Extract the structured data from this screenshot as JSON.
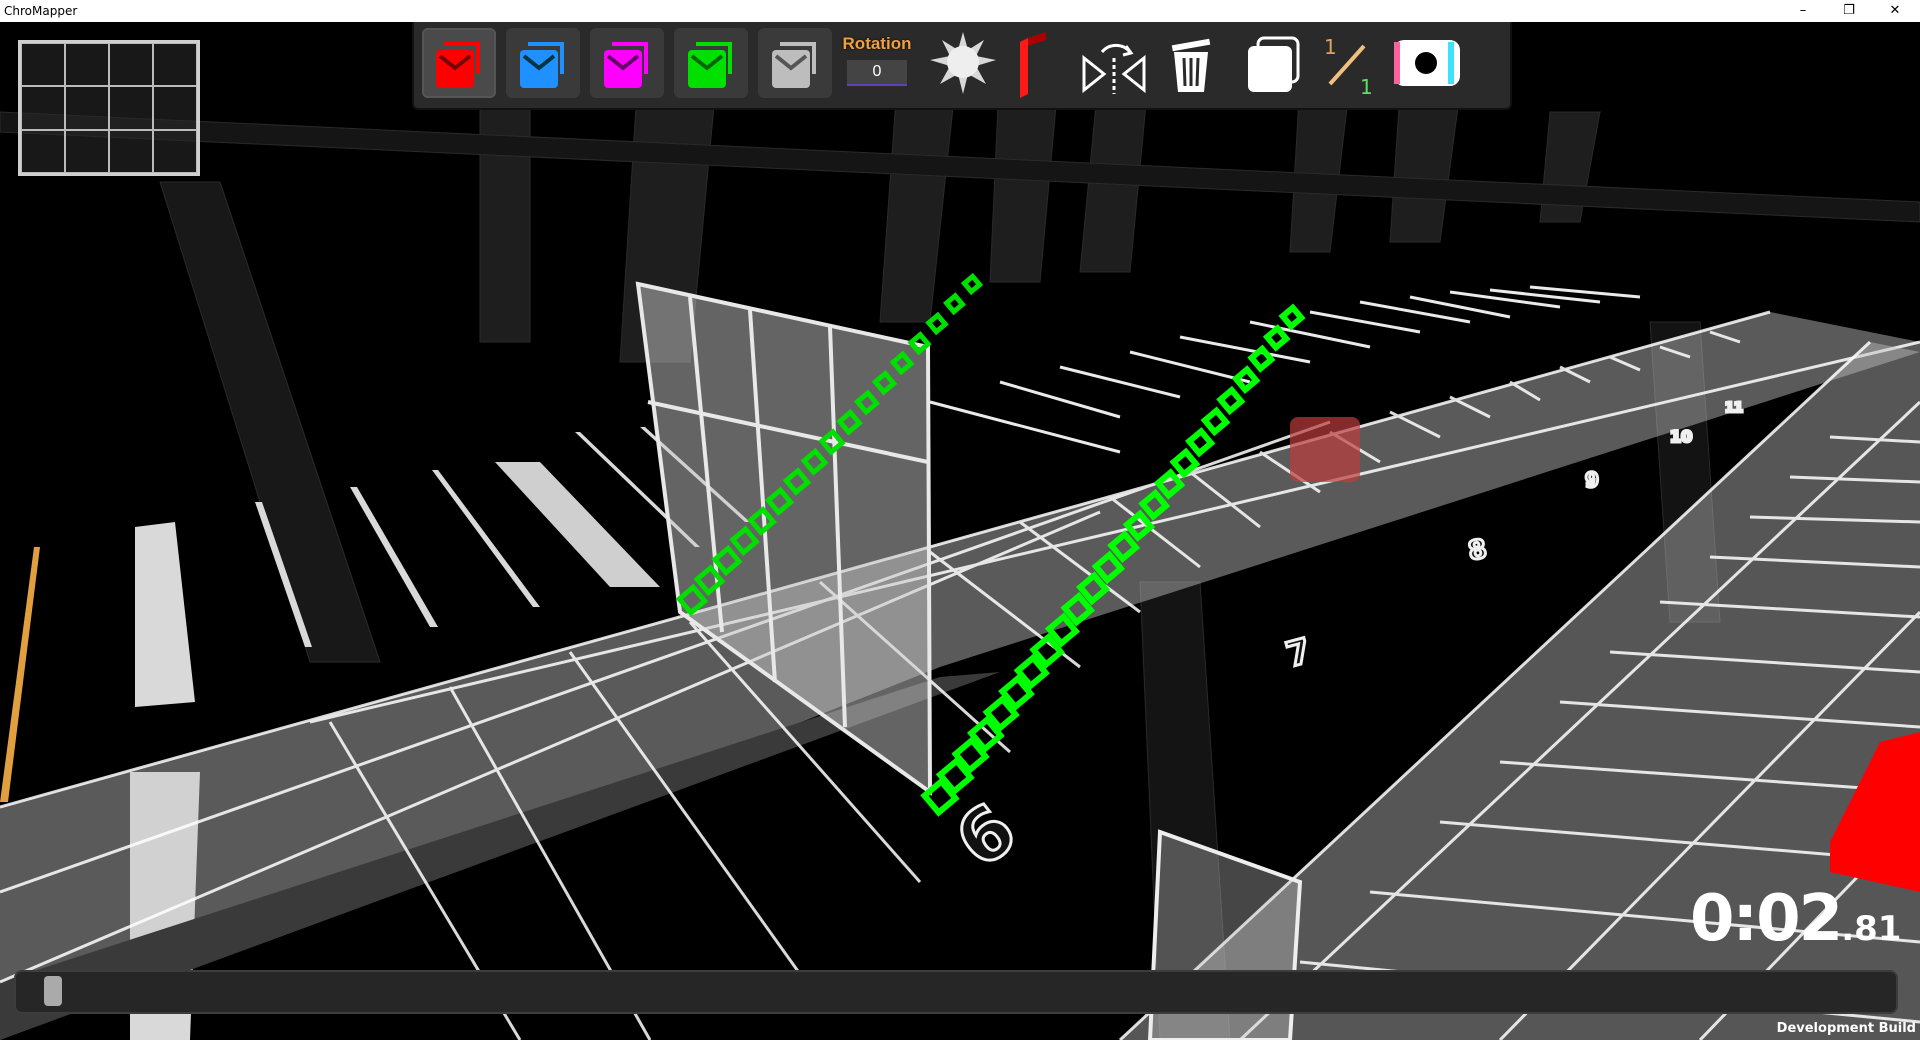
{
  "window": {
    "title": "ChroMapper",
    "minimize": "–",
    "restore": "❐",
    "close": "✕"
  },
  "toolbar": {
    "tools": [
      {
        "name": "red-note-tool",
        "color": "#ff0000",
        "selected": true
      },
      {
        "name": "blue-note-tool",
        "color": "#1e90ff"
      },
      {
        "name": "magenta-note-tool",
        "color": "#ff00ff"
      },
      {
        "name": "green-note-tool",
        "color": "#00e000"
      },
      {
        "name": "gray-note-tool",
        "color": "#bdbdbd"
      }
    ],
    "rotation_label": "Rotation",
    "rotation_value": "0",
    "fraction_numerator": "1",
    "fraction_denominator": "1"
  },
  "grid": {
    "beat_numbers": [
      "6",
      "7",
      "8",
      "9",
      "10",
      "11"
    ]
  },
  "timer": {
    "main": "0:02",
    "fraction": ".81"
  },
  "footer": {
    "build_label": "Development Build"
  },
  "colors": {
    "accent_green": "#00ff00",
    "note_red": "#ff0000",
    "toolbar_bg": "#2a2a2a",
    "rotation_orange": "#f0a040"
  }
}
